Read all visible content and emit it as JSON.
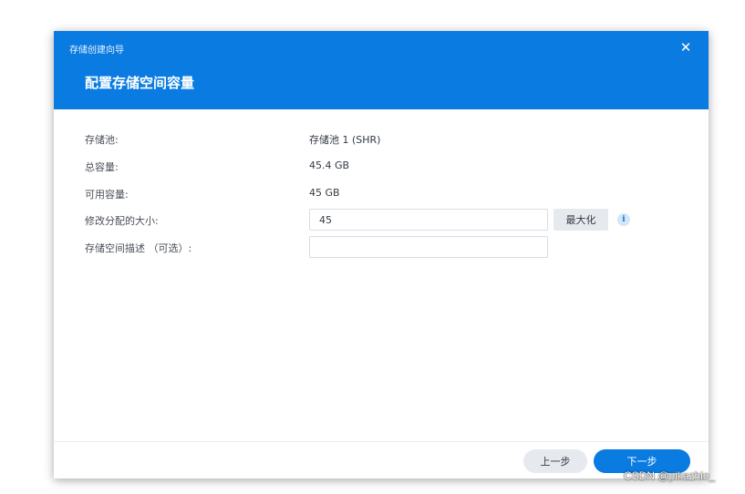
{
  "dialog": {
    "wizard_title": "存储创建向导",
    "step_title": "配置存储空间容量",
    "close_icon": "close-icon"
  },
  "form": {
    "pool_label": "存储池:",
    "pool_value": "存储池 1 (SHR)",
    "total_label": "总容量:",
    "total_value": "45.4 GB",
    "available_label": "可用容量:",
    "available_value": "45 GB",
    "size_label": "修改分配的大小:",
    "size_value": "45",
    "max_label": "最大化",
    "info_icon": "info-icon",
    "desc_label": "存储空间描述 （可选）:",
    "desc_value": ""
  },
  "footer": {
    "prev_label": "上一步",
    "next_label": "下一步"
  },
  "watermark": "CSDN @pikazhio_",
  "colors": {
    "accent": "#0a7be0",
    "button_gray": "#e6eaef"
  }
}
